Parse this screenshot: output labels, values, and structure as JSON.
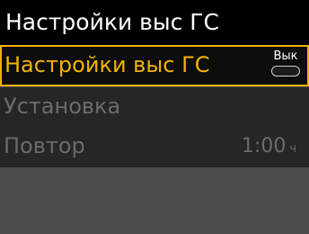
{
  "header": {
    "title": "Настройки выс ГС"
  },
  "menu": {
    "items": [
      {
        "label": "Настройки выс ГС",
        "toggle_label": "Вык"
      },
      {
        "label": "Установка"
      },
      {
        "label": "Повтор",
        "value": "1:00",
        "unit": "ч"
      }
    ]
  },
  "colors": {
    "accent": "#f2b300",
    "title_bg": "#000000",
    "background": "#4d4d4d",
    "disabled_text": "#6b6b6b"
  }
}
